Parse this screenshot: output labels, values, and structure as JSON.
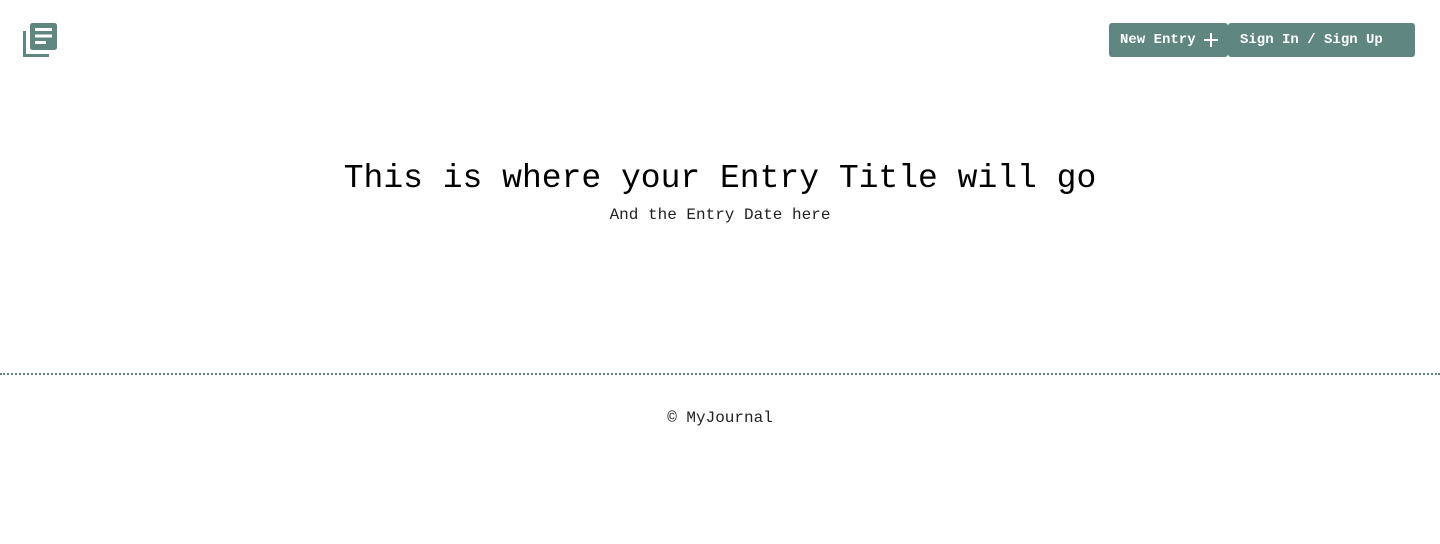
{
  "header": {
    "logo_icon": "journal-stack-icon",
    "new_entry_label": "New Entry",
    "new_entry_icon": "plus-icon",
    "auth_label": "Sign In / Sign Up"
  },
  "main": {
    "entry_title": "This is where your Entry Title will go",
    "entry_date": "And the Entry Date here"
  },
  "footer": {
    "copyright": "© MyJournal"
  },
  "colors": {
    "accent": "#5f8681",
    "background": "#ffffff",
    "text": "#000000"
  }
}
